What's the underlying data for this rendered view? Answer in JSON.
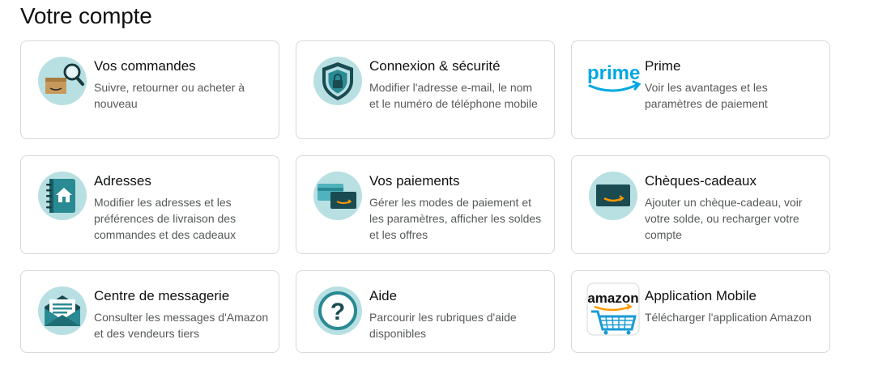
{
  "page": {
    "title": "Votre compte"
  },
  "cards": [
    {
      "title": "Vos commandes",
      "desc": "Suivre, retourner ou acheter à nouveau",
      "icon": "orders-package-search-icon"
    },
    {
      "title": "Connexion & sécurité",
      "desc": "Modifier l'adresse e-mail, le nom et le numéro de téléphone mobile",
      "icon": "shield-lock-icon"
    },
    {
      "title": "Prime",
      "desc": "Voir les avantages et les paramètres de paiement",
      "icon": "prime-logo-icon",
      "logo_text": "prime"
    },
    {
      "title": "Adresses",
      "desc": "Modifier les adresses et les préférences de livraison des commandes et des cadeaux",
      "icon": "address-book-home-icon"
    },
    {
      "title": "Vos paiements",
      "desc": "Gérer les modes de paiement et les paramètres, afficher les soldes et les offres",
      "icon": "payment-cards-icon"
    },
    {
      "title": "Chèques-cadeaux",
      "desc": "Ajouter un chèque-cadeau, voir votre solde, ou recharger votre compte",
      "icon": "gift-card-icon"
    },
    {
      "title": "Centre de messagerie",
      "desc": "Consulter les messages d'Amazon et des vendeurs tiers",
      "icon": "envelope-message-icon"
    },
    {
      "title": "Aide",
      "desc": "Parcourir les rubriques d'aide disponibles",
      "icon": "help-question-icon"
    },
    {
      "title": "Application Mobile",
      "desc": "Télécharger l'application Amazon",
      "icon": "amazon-app-cart-icon",
      "logo_text": "amazon"
    }
  ],
  "colors": {
    "icon_circle": "#b8e0e3",
    "icon_teal": "#2a8a93",
    "icon_dark": "#1a4a52",
    "amazon_orange": "#ff9900",
    "prime_blue": "#00a8e1",
    "card_border": "#d5d9d9"
  }
}
